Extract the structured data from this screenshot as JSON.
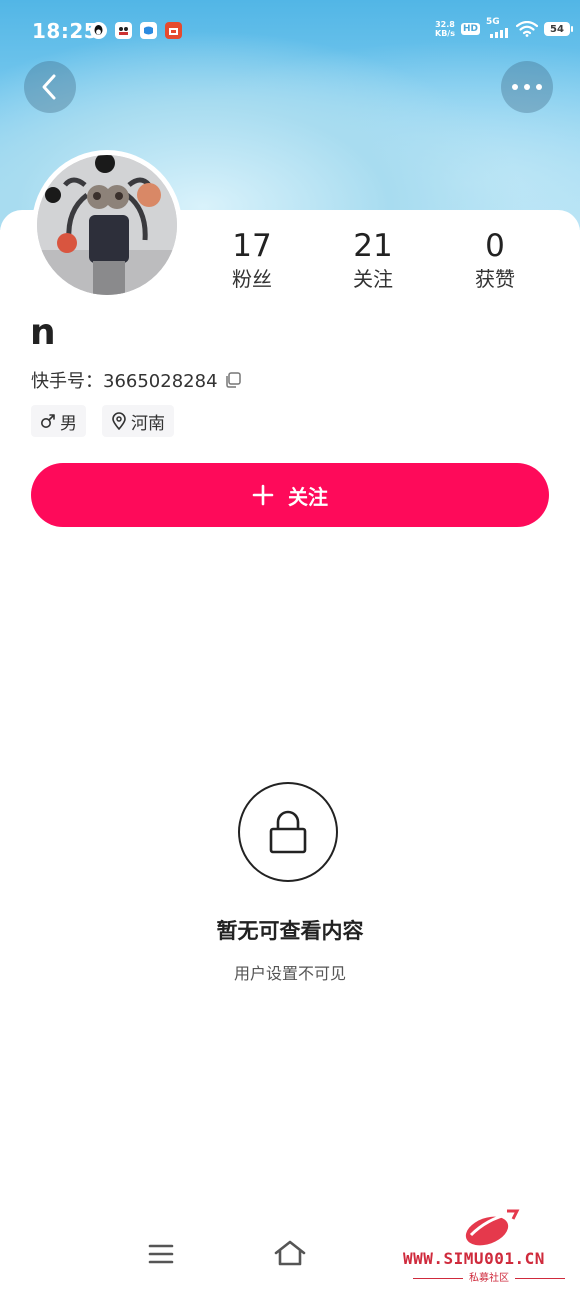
{
  "status_bar": {
    "time": "18:25",
    "net_speed_value": "32.8",
    "net_speed_unit": "KB/s",
    "hd": "HD",
    "network": "5G",
    "battery": "54"
  },
  "profile": {
    "stats": [
      {
        "value": "17",
        "label": "粉丝"
      },
      {
        "value": "21",
        "label": "关注"
      },
      {
        "value": "0",
        "label": "获赞"
      }
    ],
    "name": "n",
    "id_label": "快手号：",
    "id_value": "3665028284",
    "gender": "男",
    "location": "河南",
    "follow_label": "关注"
  },
  "empty_state": {
    "title": "暂无可查看内容",
    "subtitle": "用户设置不可见"
  },
  "watermark": {
    "url": "WWW.SIMU001.CN",
    "subtitle": "私募社区"
  },
  "colors": {
    "accent": "#fe0a5a",
    "header_top": "#52b6e6",
    "watermark": "#cf2a3c"
  }
}
